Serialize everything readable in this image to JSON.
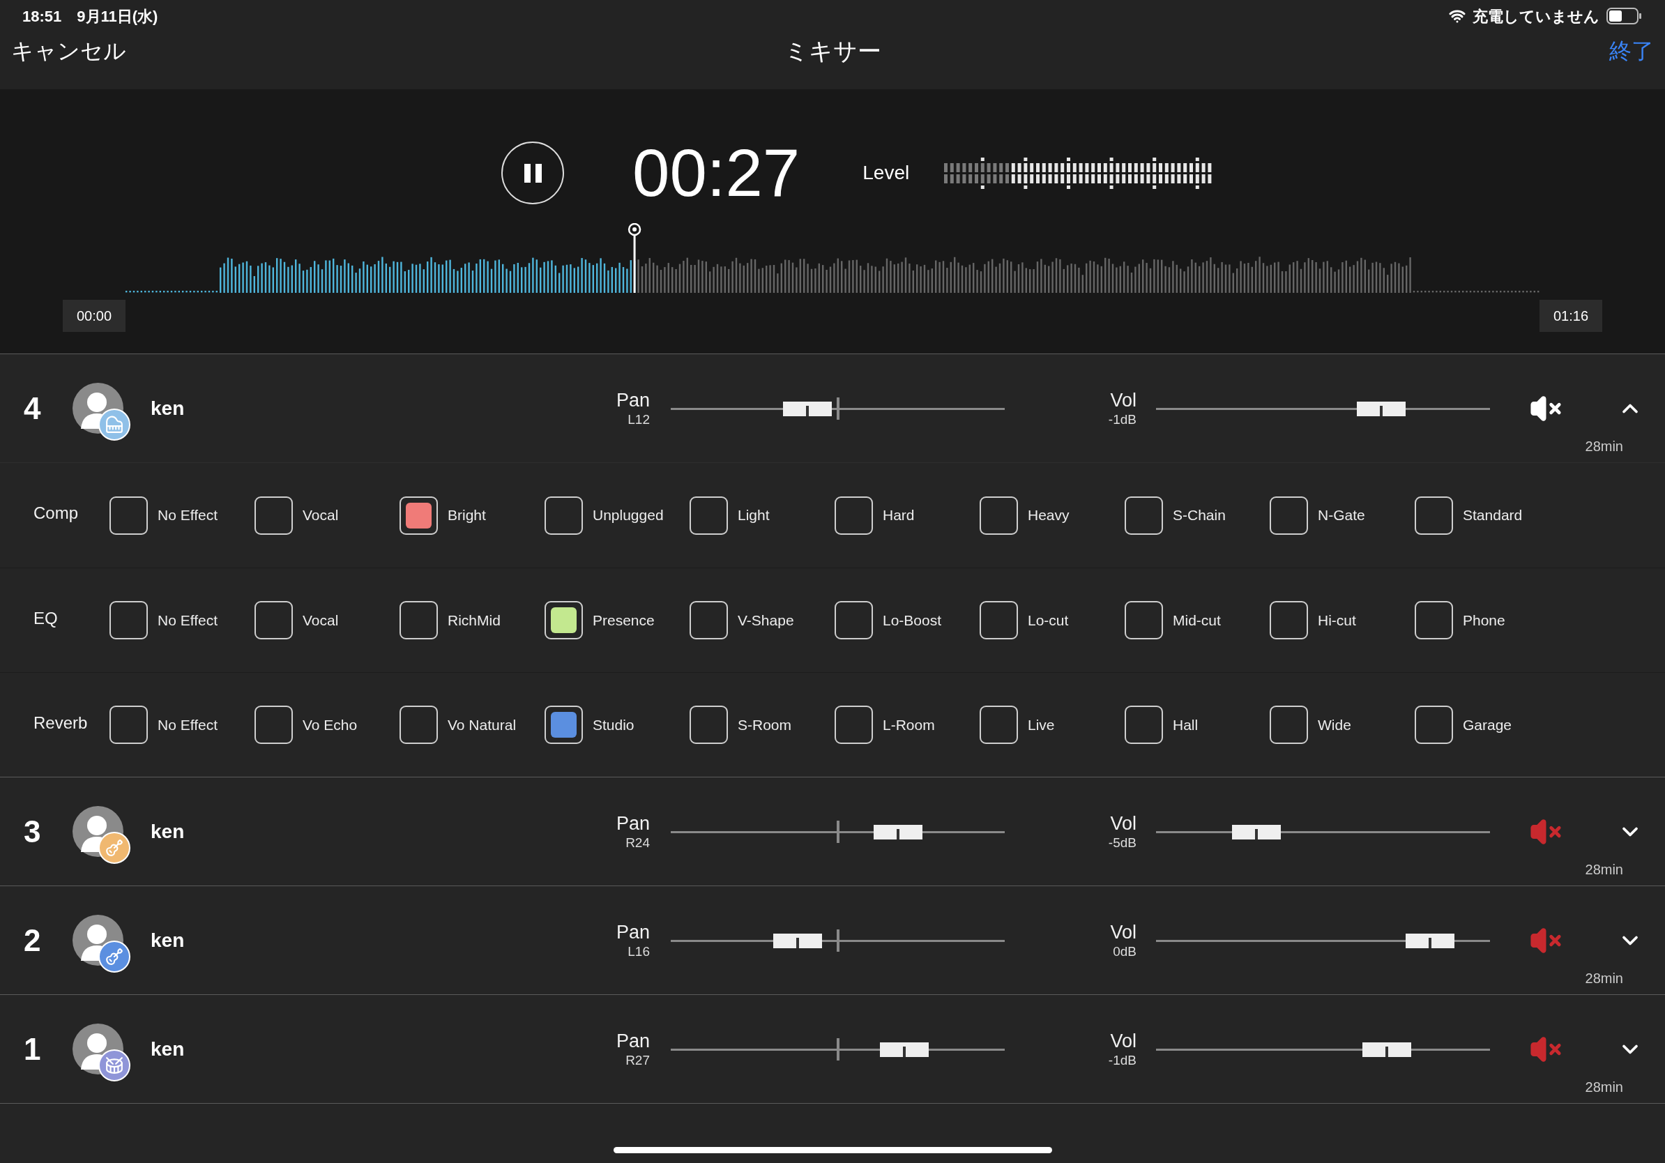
{
  "status_bar": {
    "time": "18:51",
    "date": "9月11日(水)",
    "charging": "充電していません"
  },
  "nav": {
    "cancel": "キャンセル",
    "title": "ミキサー",
    "done": "終了"
  },
  "player": {
    "elapsed": "00:27",
    "level_label": "Level",
    "start": "00:00",
    "end": "01:16",
    "level": 0.36
  },
  "tracks": [
    {
      "number": "4",
      "name": "ken",
      "kind": "piano",
      "color": "#8fc0e8",
      "pan": {
        "label": "Pan",
        "value": "L12",
        "level": 0.41
      },
      "vol": {
        "label": "Vol",
        "value": "-1dB",
        "level": 0.675
      },
      "muted": false,
      "expanded": true,
      "duration": "28min",
      "effects": [
        {
          "label": "Comp",
          "color": "#f07b78",
          "options": [
            {
              "label": "No Effect",
              "selected": false
            },
            {
              "label": "Vocal",
              "selected": false
            },
            {
              "label": "Bright",
              "selected": true
            },
            {
              "label": "Unplugged",
              "selected": false
            },
            {
              "label": "Light",
              "selected": false
            },
            {
              "label": "Hard",
              "selected": false
            },
            {
              "label": "Heavy",
              "selected": false
            },
            {
              "label": "S-Chain",
              "selected": false
            },
            {
              "label": "N-Gate",
              "selected": false
            },
            {
              "label": "Standard",
              "selected": false
            }
          ]
        },
        {
          "label": "EQ",
          "color": "#c3e88f",
          "options": [
            {
              "label": "No Effect",
              "selected": false
            },
            {
              "label": "Vocal",
              "selected": false
            },
            {
              "label": "RichMid",
              "selected": false
            },
            {
              "label": "Presence",
              "selected": true
            },
            {
              "label": "V-Shape",
              "selected": false
            },
            {
              "label": "Lo-Boost",
              "selected": false
            },
            {
              "label": "Lo-cut",
              "selected": false
            },
            {
              "label": "Mid-cut",
              "selected": false
            },
            {
              "label": "Hi-cut",
              "selected": false
            },
            {
              "label": "Phone",
              "selected": false
            }
          ]
        },
        {
          "label": "Reverb",
          "color": "#5b8fe0",
          "options": [
            {
              "label": "No Effect",
              "selected": false
            },
            {
              "label": "Vo Echo",
              "selected": false
            },
            {
              "label": "Vo Natural",
              "selected": false
            },
            {
              "label": "Studio",
              "selected": true
            },
            {
              "label": "S-Room",
              "selected": false
            },
            {
              "label": "L-Room",
              "selected": false
            },
            {
              "label": "Live",
              "selected": false
            },
            {
              "label": "Hall",
              "selected": false
            },
            {
              "label": "Wide",
              "selected": false
            },
            {
              "label": "Garage",
              "selected": false
            }
          ]
        }
      ]
    },
    {
      "number": "3",
      "name": "ken",
      "kind": "guitar",
      "color": "#f0b870",
      "pan": {
        "label": "Pan",
        "value": "R24",
        "level": 0.68
      },
      "vol": {
        "label": "Vol",
        "value": "-5dB",
        "level": 0.3
      },
      "muted": true,
      "expanded": false,
      "duration": "28min"
    },
    {
      "number": "2",
      "name": "ken",
      "kind": "electric",
      "color": "#5b8fe0",
      "pan": {
        "label": "Pan",
        "value": "L16",
        "level": 0.38
      },
      "vol": {
        "label": "Vol",
        "value": "0dB",
        "level": 0.82
      },
      "muted": true,
      "expanded": false,
      "duration": "28min"
    },
    {
      "number": "1",
      "name": "ken",
      "kind": "drums",
      "color": "#8f95d8",
      "pan": {
        "label": "Pan",
        "value": "R27",
        "level": 0.7
      },
      "vol": {
        "label": "Vol",
        "value": "-1dB",
        "level": 0.69
      },
      "muted": true,
      "expanded": false,
      "duration": "28min"
    }
  ]
}
